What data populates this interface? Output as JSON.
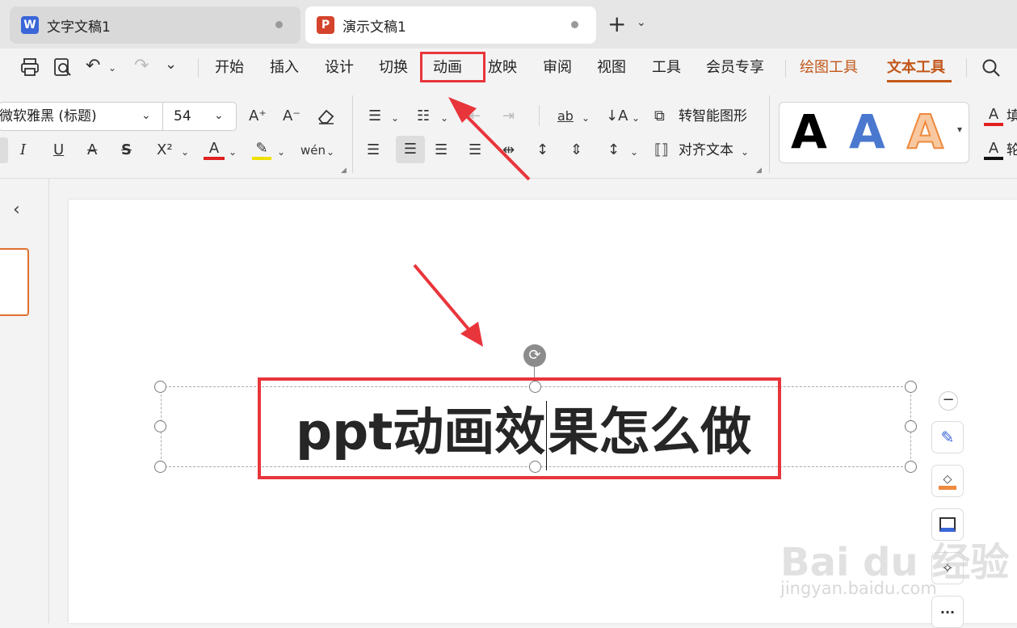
{
  "tabs": [
    {
      "label": "文字文稿1",
      "icon": "W"
    },
    {
      "label": "演示文稿1",
      "icon": "P"
    }
  ],
  "menu": {
    "items": [
      "开始",
      "插入",
      "设计",
      "切换",
      "动画",
      "放映",
      "审阅",
      "视图",
      "工具",
      "会员专享",
      "绘图工具",
      "文本工具"
    ]
  },
  "ribbon": {
    "font_name": "微软雅黑 (标题)",
    "font_size": "54",
    "smart_shape": "转智能图形",
    "align_text": "对齐文本",
    "styles": [
      "A",
      "A",
      "A"
    ],
    "right_labels": [
      "填",
      "轮"
    ]
  },
  "slide": {
    "title_before_cursor": "ppt动画效",
    "title_after_cursor": "果怎么做"
  },
  "watermark": {
    "brand": "Bai du 经验",
    "url": "jingyan.baidu.com"
  },
  "colors": {
    "accent": "#c2571a",
    "highlight_box": "#e8353b",
    "wps_writer": "#3a66d8",
    "wps_presentation": "#d4432b"
  }
}
